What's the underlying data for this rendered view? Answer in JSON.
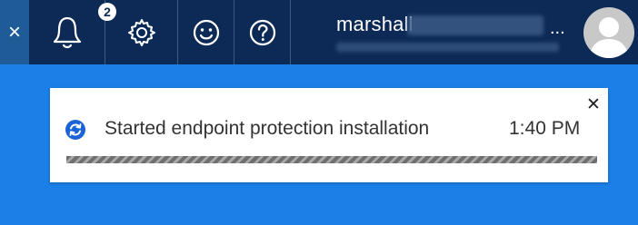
{
  "topbar": {
    "close_glyph": "×",
    "notification_count": "2",
    "icons": [
      "close-icon",
      "bell-icon",
      "gear-icon",
      "smiley-icon",
      "help-icon"
    ]
  },
  "user": {
    "name_partial": "marshall",
    "ellipsis": "..."
  },
  "notification": {
    "message": "Started endpoint protection installation",
    "time": "1:40 PM",
    "close_glyph": "✕",
    "icon": "sync-icon"
  },
  "colors": {
    "topbar": "#0c2a55",
    "accent": "#1a7fe6",
    "toast_bg": "#ffffff",
    "icon_blue": "#1b63d6"
  }
}
